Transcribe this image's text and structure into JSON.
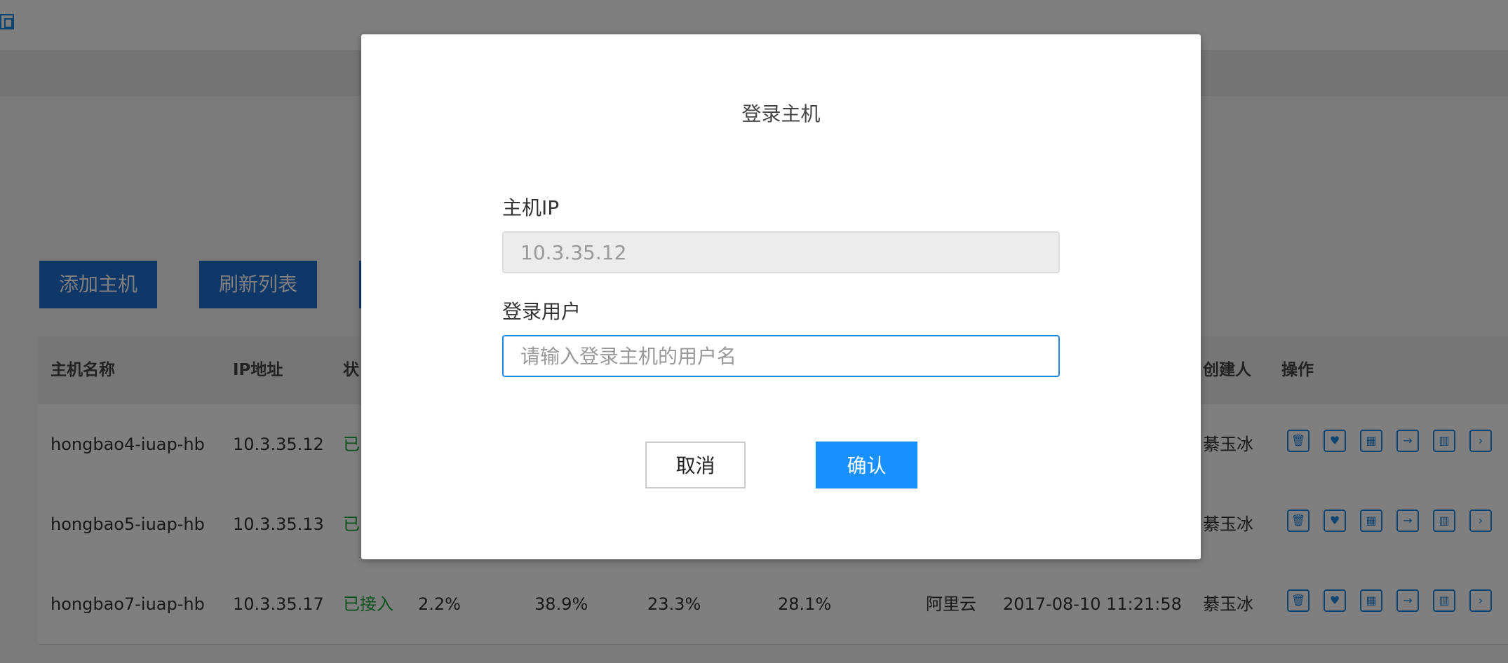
{
  "toolbar": {
    "add_host": "添加主机",
    "refresh_list": "刷新列表"
  },
  "table": {
    "headers": {
      "host_name": "主机名称",
      "ip": "IP地址",
      "status": "状",
      "creator": "创建人",
      "ops": "操作"
    },
    "rows": [
      {
        "host": "hongbao4-iuap-hb",
        "ip": "10.3.35.12",
        "status": "已",
        "creator": "綦玉冰"
      },
      {
        "host": "hongbao5-iuap-hb",
        "ip": "10.3.35.13",
        "status": "已",
        "creator": "綦玉冰"
      },
      {
        "host": "hongbao7-iuap-hb",
        "ip": "10.3.35.17",
        "status": "已接入",
        "cpu": "2.2%",
        "mem": "38.9%",
        "disk": "23.3%",
        "other": "28.1%",
        "provider": "阿里云",
        "created": "2017-08-10 11:21:58",
        "creator": "綦玉冰"
      }
    ],
    "op_icons": [
      "delete-icon",
      "heart-icon",
      "grid-icon",
      "folder-icon",
      "bar-chart-icon",
      "terminal-icon"
    ]
  },
  "modal": {
    "title": "登录主机",
    "host_ip_label": "主机IP",
    "host_ip_value": "10.3.35.12",
    "login_user_label": "登录用户",
    "login_user_placeholder": "请输入登录主机的用户名",
    "cancel": "取消",
    "confirm": "确认"
  },
  "colors": {
    "primary": "#1890ff",
    "toolbar_button": "#1e6fd0",
    "status_green": "#1aa23e"
  }
}
